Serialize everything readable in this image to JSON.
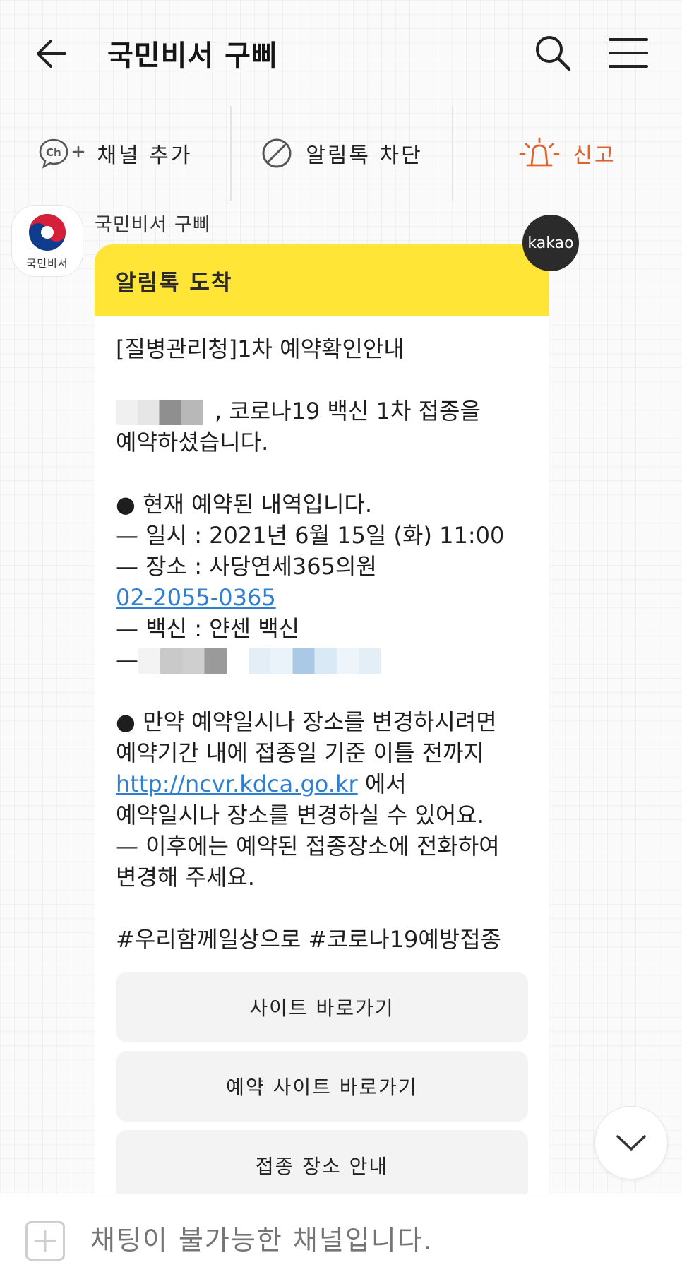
{
  "header": {
    "title": "국민비서 구삐"
  },
  "actions": {
    "add_channel": "채널 추가",
    "block": "알림톡 차단",
    "report": "신고"
  },
  "chat": {
    "sender_name": "국민비서 구삐",
    "avatar_label": "국민비서",
    "badge": "kakao",
    "bubble_title": "알림톡 도착",
    "lines": {
      "heading": "[질병관리청]1차 예약확인안내",
      "greeting_rest": ", 코로나19 백신 1차 접종을",
      "reserved": "예약하셨습니다.",
      "current": "● 현재 예약된 내역입니다.",
      "datetime": "— 일시 : 2021년 6월 15일 (화) 11:00",
      "place": "— 장소 : 사당연세365의원",
      "phone": "02-2055-0365",
      "vaccine": "— 백신 : 얀센 백신",
      "dash": "—",
      "change1": "● 만약 예약일시나 장소를 변경하시려면",
      "change2": "예약기간 내에 접종일 기준 이틀 전까지",
      "url": "http://ncvr.kdca.go.kr",
      "url_rest": " 에서",
      "change3": "예약일시나 장소를 변경하실 수 있어요.",
      "after1": "— 이후에는 예약된 접종장소에 전화하여",
      "after2": "변경해 주세요.",
      "hashtags": "#우리함께일상으로 #코로나19예방접종"
    },
    "buttons": {
      "site": "사이트 바로가기",
      "reserve_site": "예약 사이트 바로가기",
      "place_info": "접종 장소 안내"
    }
  },
  "input": {
    "placeholder": "채팅이 불가능한 채널입니다."
  },
  "colors": {
    "bubble_header": "#ffe536",
    "link": "#2f7fd1",
    "report": "#e0632e"
  }
}
